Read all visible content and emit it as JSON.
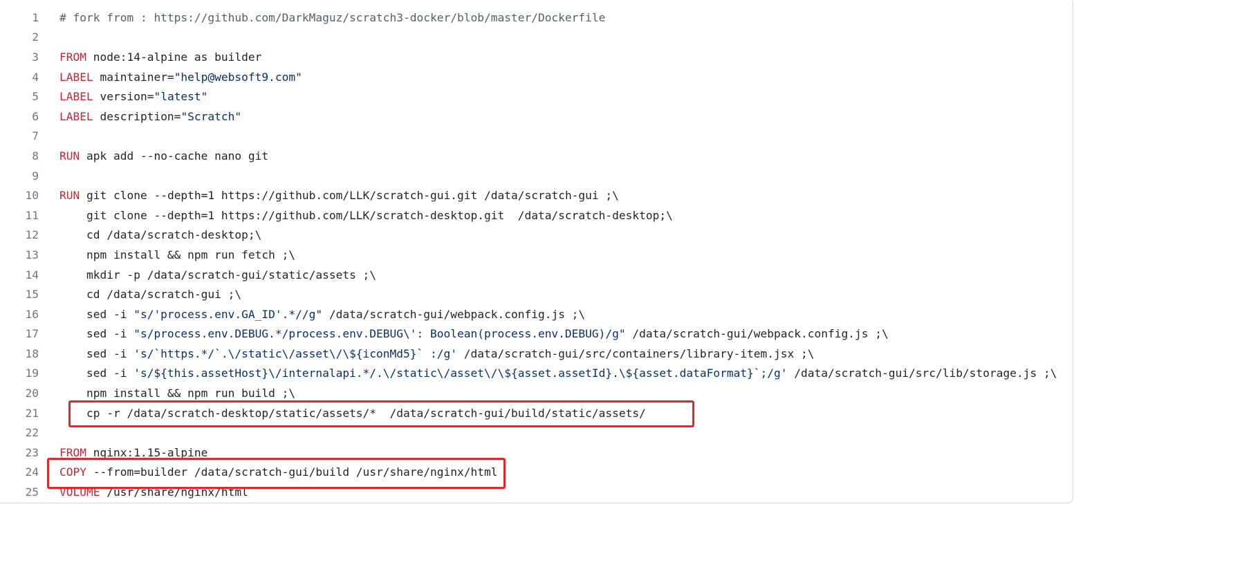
{
  "file": {
    "lines": [
      {
        "n": "1",
        "parts": [
          {
            "t": "# fork from : https://github.com/DarkMaguz/scratch3-docker/blob/master/Dockerfile",
            "c": "comment"
          }
        ]
      },
      {
        "n": "2",
        "parts": []
      },
      {
        "n": "3",
        "parts": [
          {
            "t": "FROM",
            "c": "kw"
          },
          {
            "t": " node:14-alpine as builder",
            "c": "plain"
          }
        ]
      },
      {
        "n": "4",
        "parts": [
          {
            "t": "LABEL",
            "c": "kw"
          },
          {
            "t": " maintainer=",
            "c": "plain"
          },
          {
            "t": "\"help@websoft9.com\"",
            "c": "str"
          }
        ]
      },
      {
        "n": "5",
        "parts": [
          {
            "t": "LABEL",
            "c": "kw"
          },
          {
            "t": " version=",
            "c": "plain"
          },
          {
            "t": "\"latest\"",
            "c": "str"
          }
        ]
      },
      {
        "n": "6",
        "parts": [
          {
            "t": "LABEL",
            "c": "kw"
          },
          {
            "t": " description=",
            "c": "plain"
          },
          {
            "t": "\"Scratch\"",
            "c": "str"
          }
        ]
      },
      {
        "n": "7",
        "parts": []
      },
      {
        "n": "8",
        "parts": [
          {
            "t": "RUN",
            "c": "kw"
          },
          {
            "t": " apk add --no-cache nano git",
            "c": "plain"
          }
        ]
      },
      {
        "n": "9",
        "parts": []
      },
      {
        "n": "10",
        "parts": [
          {
            "t": "RUN",
            "c": "kw"
          },
          {
            "t": " git clone --depth=1 https://github.com/LLK/scratch-gui.git /data/scratch-gui ;\\",
            "c": "plain"
          }
        ]
      },
      {
        "n": "11",
        "parts": [
          {
            "t": "    git clone --depth=1 https://github.com/LLK/scratch-desktop.git  /data/scratch-desktop;\\",
            "c": "plain"
          }
        ]
      },
      {
        "n": "12",
        "parts": [
          {
            "t": "    cd /data/scratch-desktop;\\",
            "c": "plain"
          }
        ]
      },
      {
        "n": "13",
        "parts": [
          {
            "t": "    npm install && npm run fetch ;\\",
            "c": "plain"
          }
        ]
      },
      {
        "n": "14",
        "parts": [
          {
            "t": "    mkdir -p /data/scratch-gui/static/assets ;\\",
            "c": "plain"
          }
        ]
      },
      {
        "n": "15",
        "parts": [
          {
            "t": "    cd /data/scratch-gui ;\\",
            "c": "plain"
          }
        ]
      },
      {
        "n": "16",
        "parts": [
          {
            "t": "    sed -i ",
            "c": "plain"
          },
          {
            "t": "\"s/'process.env.GA_ID'.*//g\"",
            "c": "str"
          },
          {
            "t": " /data/scratch-gui/webpack.config.js ;\\",
            "c": "plain"
          }
        ]
      },
      {
        "n": "17",
        "parts": [
          {
            "t": "    sed -i ",
            "c": "plain"
          },
          {
            "t": "\"s/process.env.DEBUG.*/process.env.DEBUG\\': Boolean(process.env.DEBUG)/g\"",
            "c": "str"
          },
          {
            "t": " /data/scratch-gui/webpack.config.js ;\\",
            "c": "plain"
          }
        ]
      },
      {
        "n": "18",
        "parts": [
          {
            "t": "    sed -i ",
            "c": "plain"
          },
          {
            "t": "'s/`https.*/`.\\/static\\/asset\\/\\${iconMd5}` :/g'",
            "c": "str"
          },
          {
            "t": " /data/scratch-gui/src/containers/library-item.jsx ;\\",
            "c": "plain"
          }
        ]
      },
      {
        "n": "19",
        "parts": [
          {
            "t": "    sed -i ",
            "c": "plain"
          },
          {
            "t": "'s/${this.assetHost}\\/internalapi.*/.\\/static\\/asset\\/\\${asset.assetId}.\\${asset.dataFormat}`;/g'",
            "c": "str"
          },
          {
            "t": " /data/scratch-gui/src/lib/storage.js ;\\",
            "c": "plain"
          }
        ]
      },
      {
        "n": "20",
        "parts": [
          {
            "t": "    npm install && npm run build ;\\",
            "c": "plain"
          }
        ]
      },
      {
        "n": "21",
        "parts": [
          {
            "t": "    cp -r /data/scratch-desktop/static/assets/*  /data/scratch-gui/build/static/assets/",
            "c": "plain"
          }
        ]
      },
      {
        "n": "22",
        "parts": []
      },
      {
        "n": "23",
        "parts": [
          {
            "t": "FROM",
            "c": "kw"
          },
          {
            "t": " nginx:1.15-alpine",
            "c": "plain"
          }
        ]
      },
      {
        "n": "24",
        "parts": [
          {
            "t": "COPY",
            "c": "kw"
          },
          {
            "t": " --from=builder /data/scratch-gui/build /usr/share/nginx/html",
            "c": "plain"
          }
        ]
      },
      {
        "n": "25",
        "parts": [
          {
            "t": "VOLUME",
            "c": "kw"
          },
          {
            "t": " /usr/share/nginx/html",
            "c": "plain"
          }
        ]
      }
    ]
  },
  "annotations": {
    "box_color": "#e3262a",
    "highlighted_lines": [
      "21",
      "24"
    ]
  },
  "colors": {
    "keyword": "#cf222e",
    "string": "#0a3069",
    "comment": "#57606a",
    "text": "#1f2328",
    "line_number": "#6e7781"
  }
}
